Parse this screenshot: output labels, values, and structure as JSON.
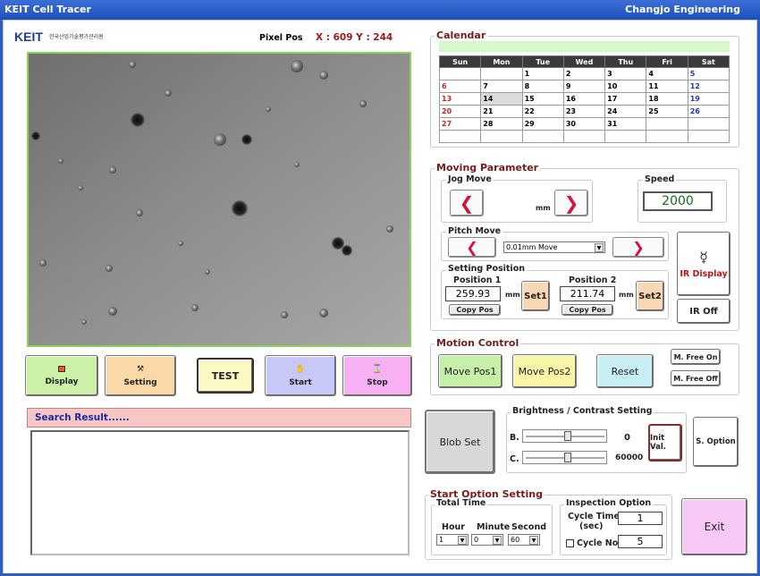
{
  "window": {
    "title": "KEIT Cell Tracer",
    "vendor": "Changjo Engineering"
  },
  "header": {
    "logo_text": "KEIT",
    "logo_sub": "한국산업기술평가관리원",
    "pixel_label": "Pixel Pos",
    "pixel_value": "X : 609 Y : 244"
  },
  "calendar": {
    "title": "Calendar",
    "headers": [
      "Sun",
      "Mon",
      "Tue",
      "Wed",
      "Thu",
      "Fri",
      "Sat"
    ],
    "rows": [
      [
        "",
        "",
        "1",
        "2",
        "3",
        "4",
        "5"
      ],
      [
        "6",
        "7",
        "8",
        "9",
        "10",
        "11",
        "12"
      ],
      [
        "13",
        "14",
        "15",
        "16",
        "17",
        "18",
        "19"
      ],
      [
        "20",
        "21",
        "22",
        "23",
        "24",
        "25",
        "26"
      ],
      [
        "27",
        "28",
        "29",
        "30",
        "31",
        "",
        ""
      ],
      [
        "",
        "",
        "",
        "",
        "",
        "",
        ""
      ]
    ]
  },
  "moving": {
    "title": "Moving Parameter",
    "jog_title": "Jog Move",
    "jog_unit": "mm",
    "speed_title": "Speed",
    "speed_value": "2000",
    "pitch_title": "Pitch Move",
    "pitch_option": "0.01mm Move",
    "setting_title": "Setting Position",
    "pos1_label": "Position 1",
    "pos1_value": "259.93",
    "pos2_label": "Position 2",
    "pos2_value": "211.74",
    "unit": "mm",
    "set1": "Set1",
    "set2": "Set2",
    "copy1": "Copy Pos",
    "copy2": "Copy Pos",
    "ir_display": "IR Display",
    "ir_off": "IR Off"
  },
  "motion": {
    "title": "Motion Control",
    "move1": "Move Pos1",
    "move2": "Move Pos2",
    "reset": "Reset",
    "free_on": "M. Free On",
    "free_off": "M. Free Off"
  },
  "bc": {
    "title": "Brightness / Contrast Setting",
    "b_label": "B.",
    "c_label": "C.",
    "b_value": "0",
    "c_value": "60000",
    "b_level": 0.5,
    "c_level": 0.5,
    "init": "Init Val.",
    "option": "S. Option"
  },
  "blob_set": "Blob Set",
  "start_opt": {
    "title": "Start Option Setting",
    "total_title": "Total Time",
    "hour_label": "Hour",
    "minute_label": "Minute",
    "second_label": "Second",
    "hour_value": "1",
    "minute_value": "0",
    "second_value": "60",
    "insp_title": "Inspection Option",
    "cycle_time_label": "Cycle Time",
    "cycle_time_unit": "(sec)",
    "cycle_time_value": "1",
    "cycle_no_label": "Cycle No",
    "cycle_no_value": "5"
  },
  "exit": "Exit",
  "toolbar": {
    "display": "Display",
    "setting": "Setting",
    "test": "TEST",
    "start": "Start",
    "stop": "Stop"
  },
  "search": {
    "title": "Search Result......"
  },
  "colors": {
    "display_bg": "#cdf0a8",
    "setting_bg": "#fbd8a8",
    "test_bg": "#fcf8c4",
    "start_bg": "#c8c8f8",
    "stop_bg": "#f8b0f4",
    "search_header": "#f9c6c6",
    "move_bg": "#c6f0a8",
    "move2_bg": "#faf6a8",
    "reset_bg": "#c8f0f4",
    "set_bg": "#f8d8b4",
    "exit_bg": "#f8c8f4",
    "calendar_bar": "#d6f8cc"
  }
}
